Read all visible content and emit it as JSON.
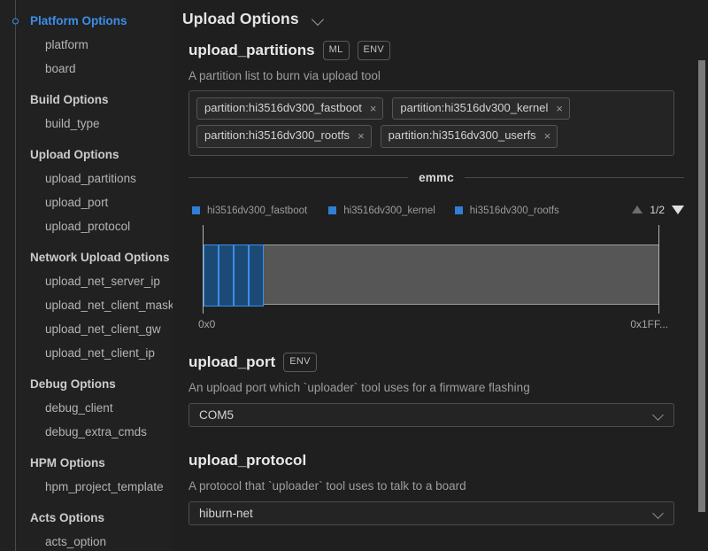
{
  "sidebar": {
    "items": [
      {
        "label": "Platform Options",
        "type": "group",
        "active": true,
        "dot": true
      },
      {
        "label": "platform",
        "type": "leaf"
      },
      {
        "label": "board",
        "type": "leaf"
      },
      {
        "label": "Build Options",
        "type": "group",
        "active": false
      },
      {
        "label": "build_type",
        "type": "leaf"
      },
      {
        "label": "Upload Options",
        "type": "group",
        "active": false
      },
      {
        "label": "upload_partitions",
        "type": "leaf"
      },
      {
        "label": "upload_port",
        "type": "leaf"
      },
      {
        "label": "upload_protocol",
        "type": "leaf"
      },
      {
        "label": "Network Upload Options",
        "type": "group",
        "active": false
      },
      {
        "label": "upload_net_server_ip",
        "type": "leaf"
      },
      {
        "label": "upload_net_client_mask",
        "type": "leaf"
      },
      {
        "label": "upload_net_client_gw",
        "type": "leaf"
      },
      {
        "label": "upload_net_client_ip",
        "type": "leaf"
      },
      {
        "label": "Debug Options",
        "type": "group",
        "active": false
      },
      {
        "label": "debug_client",
        "type": "leaf"
      },
      {
        "label": "debug_extra_cmds",
        "type": "leaf"
      },
      {
        "label": "HPM Options",
        "type": "group",
        "active": false
      },
      {
        "label": "hpm_project_template",
        "type": "leaf"
      },
      {
        "label": "Acts Options",
        "type": "group",
        "active": false
      },
      {
        "label": "acts_option",
        "type": "leaf"
      }
    ]
  },
  "header": {
    "title": "Upload Options",
    "collapse_icon": "chevron-down-icon"
  },
  "fields": {
    "upload_partitions": {
      "name": "upload_partitions",
      "badges": [
        "ML",
        "ENV"
      ],
      "description": "A partition list to burn via upload tool",
      "chips": [
        {
          "label": "partition:hi3516dv300_fastboot",
          "remove": "×"
        },
        {
          "label": "partition:hi3516dv300_kernel",
          "remove": "×"
        },
        {
          "label": "partition:hi3516dv300_rootfs",
          "remove": "×"
        },
        {
          "label": "partition:hi3516dv300_userfs",
          "remove": "×"
        }
      ]
    },
    "upload_port": {
      "name": "upload_port",
      "badges": [
        "ENV"
      ],
      "description": "An upload port which `uploader` tool uses for a firmware flashing",
      "value": "COM5",
      "caret_icon": "chevron-down-icon"
    },
    "upload_protocol": {
      "name": "upload_protocol",
      "badges": [],
      "description": "A protocol that `uploader` tool uses to talk to a board",
      "value": "hiburn-net",
      "caret_icon": "chevron-down-icon"
    }
  },
  "chart_data": {
    "type": "bar",
    "title": "emmc",
    "orientation": "horizontal-stacked",
    "xlabel": "",
    "ylabel": "",
    "axis_ticks": [
      "0x0",
      "0x1FF..."
    ],
    "xlim": [
      0,
      1
    ],
    "grid": false,
    "legend_position": "top",
    "legend": [
      {
        "name": "hi3516dv300_fastboot",
        "color": "#2f7fd4"
      },
      {
        "name": "hi3516dv300_kernel",
        "color": "#2f7fd4"
      },
      {
        "name": "hi3516dv300_rootfs",
        "color": "#2f7fd4"
      }
    ],
    "legend_page": "1/2",
    "legend_page_prev_icon": "triangle-up-icon",
    "legend_page_next_icon": "triangle-down-icon",
    "track_color": "#565656",
    "segment_fill": "#1c4a77",
    "segment_border": "#3b8eea",
    "segments": [
      {
        "name": "hi3516dv300_fastboot",
        "start_pct": 0.0,
        "width_pct": 3.3
      },
      {
        "name": "hi3516dv300_kernel",
        "start_pct": 3.3,
        "width_pct": 3.3
      },
      {
        "name": "hi3516dv300_rootfs",
        "start_pct": 6.6,
        "width_pct": 3.3
      },
      {
        "name": "hi3516dv300_userfs",
        "start_pct": 9.9,
        "width_pct": 3.3
      }
    ]
  },
  "scrollbar": {
    "thumb_top_pct": 11,
    "thumb_height_pct": 82
  },
  "colors": {
    "background": "#1f1f1f",
    "sidebar_background": "#212121",
    "accent": "#3b8eea",
    "text_primary": "#e4e4e4",
    "text_secondary": "#9d9d9d"
  }
}
